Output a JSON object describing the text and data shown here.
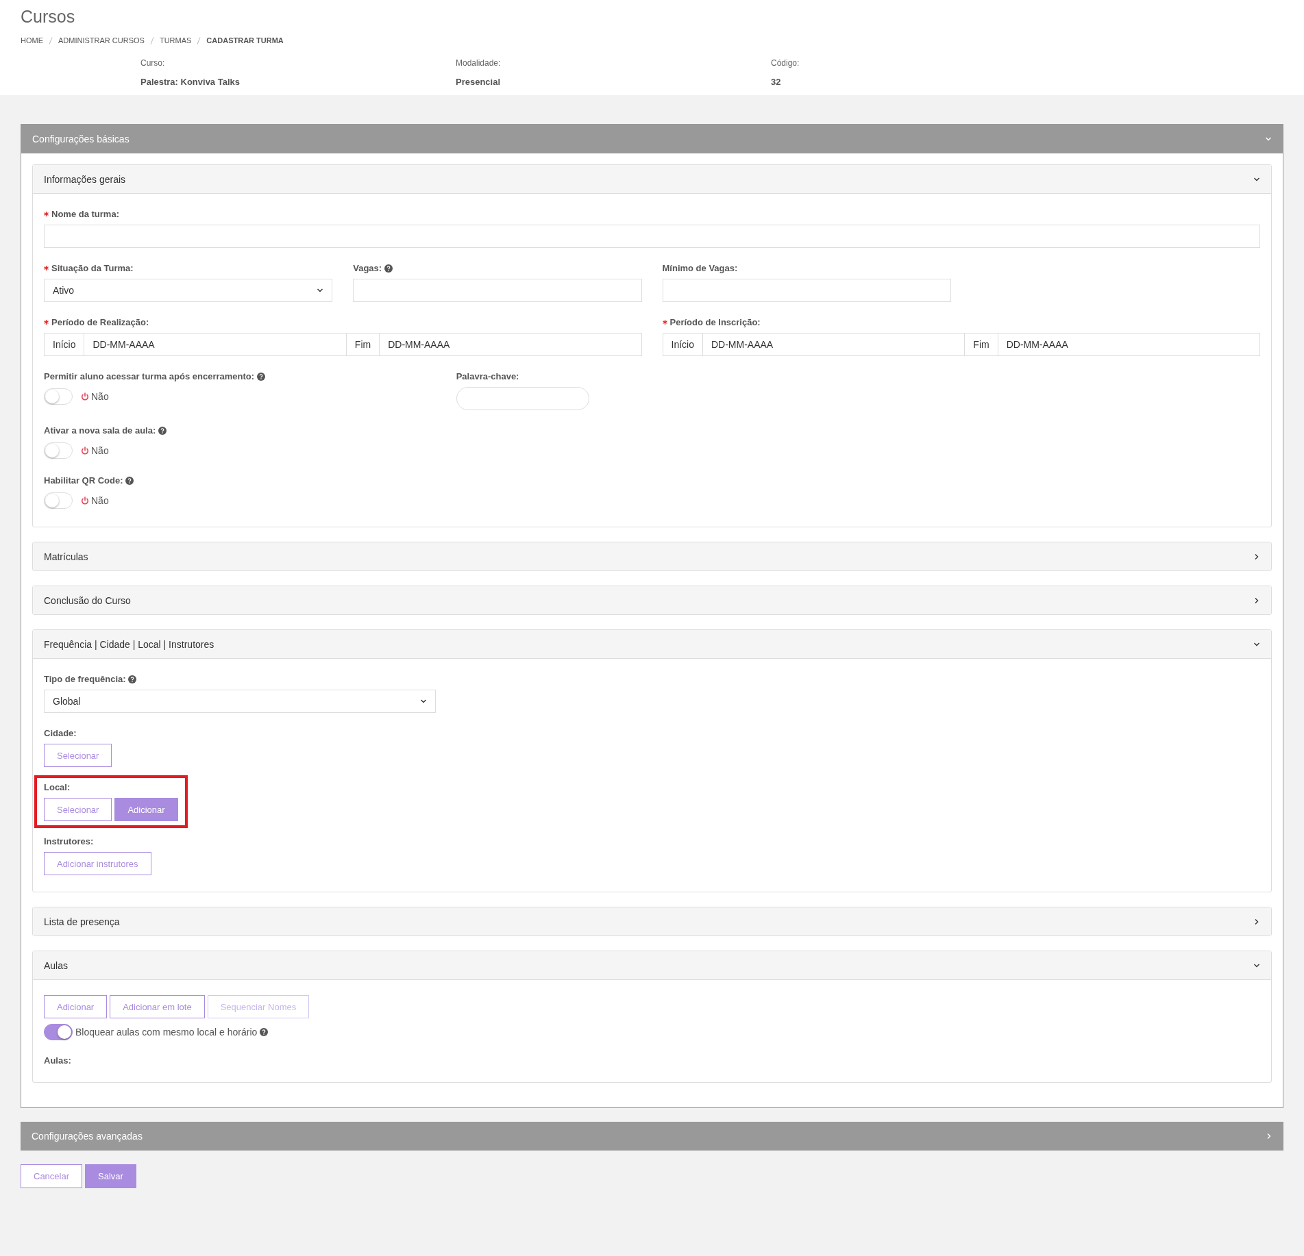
{
  "page": {
    "title": "Cursos"
  },
  "breadcrumb": [
    {
      "label": "HOME",
      "current": false
    },
    {
      "label": "ADMINISTRAR CURSOS",
      "current": false
    },
    {
      "label": "TURMAS",
      "current": false
    },
    {
      "label": "CADASTRAR TURMA",
      "current": true
    }
  ],
  "course_info": [
    {
      "label": "Curso:",
      "value": "Palestra: Konviva Talks"
    },
    {
      "label": "Modalidade:",
      "value": "Presencial"
    },
    {
      "label": "Código:",
      "value": "32"
    }
  ],
  "sections": [
    {
      "title": "Configurações básicas",
      "expanded": true,
      "panels": [
        {
          "title": "Informações gerais",
          "expanded": true,
          "rows": [
            {
              "fields": [
                {
                  "kind": "text",
                  "label": "Nome da turma:",
                  "required": true,
                  "help": false
                }
              ]
            },
            {
              "fields": [
                {
                  "kind": "select",
                  "label": "Situação da Turma:",
                  "required": true,
                  "help": false,
                  "value": "Ativo"
                },
                {
                  "kind": "text",
                  "label": "Vagas:",
                  "required": false,
                  "help": true
                },
                {
                  "kind": "text",
                  "label": "Mínimo de Vagas:",
                  "required": false,
                  "help": false
                }
              ]
            },
            {
              "fields": [
                {
                  "kind": "daterange",
                  "label": "Período de Realização:",
                  "required": true,
                  "help": false,
                  "start_label": "Início",
                  "start_value": "DD-MM-AAAA",
                  "end_label": "Fim",
                  "end_value": "DD-MM-AAAA"
                },
                {
                  "kind": "daterange",
                  "label": "Período de Inscrição:",
                  "required": true,
                  "help": false,
                  "start_label": "Início",
                  "start_value": "DD-MM-AAAA",
                  "end_label": "Fim",
                  "end_value": "DD-MM-AAAA"
                }
              ]
            },
            {
              "fields": [
                {
                  "kind": "toggle",
                  "label": "Permitir aluno acessar turma após encerramento:",
                  "required": false,
                  "help": true,
                  "on": false,
                  "state_text": "Não"
                },
                {
                  "kind": "keyword",
                  "label": "Palavra-chave:",
                  "required": false,
                  "help": false
                }
              ]
            },
            {
              "fields": [
                {
                  "kind": "toggle",
                  "label": "Ativar a nova sala de aula:",
                  "required": false,
                  "help": true,
                  "on": false,
                  "state_text": "Não"
                }
              ]
            },
            {
              "fields": [
                {
                  "kind": "toggle",
                  "label": "Habilitar QR Code:",
                  "required": false,
                  "help": true,
                  "on": false,
                  "state_text": "Não"
                }
              ]
            }
          ]
        },
        {
          "title": "Matrículas",
          "expanded": false
        },
        {
          "title": "Conclusão do Curso",
          "expanded": false
        },
        {
          "title": "Frequência | Cidade | Local | Instrutores",
          "expanded": true,
          "rows": [
            {
              "fields": [
                {
                  "kind": "select",
                  "label": "Tipo de frequência:",
                  "required": false,
                  "help": true,
                  "value": "Global"
                }
              ]
            },
            {
              "fields": [
                {
                  "kind": "buttons",
                  "label": "Cidade:",
                  "highlighted": false,
                  "buttons": [
                    {
                      "label": "Selecionar",
                      "primary": false,
                      "disabled": false
                    }
                  ]
                }
              ]
            },
            {
              "fields": [
                {
                  "kind": "buttons",
                  "label": "Local:",
                  "highlighted": true,
                  "buttons": [
                    {
                      "label": "Selecionar",
                      "primary": false,
                      "disabled": false
                    },
                    {
                      "label": "Adicionar",
                      "primary": true,
                      "disabled": false
                    }
                  ]
                }
              ]
            },
            {
              "fields": [
                {
                  "kind": "buttons",
                  "label": "Instrutores:",
                  "highlighted": false,
                  "buttons": [
                    {
                      "label": "Adicionar instrutores",
                      "primary": false,
                      "disabled": false
                    }
                  ]
                }
              ]
            }
          ]
        },
        {
          "title": "Lista de presença",
          "expanded": false
        },
        {
          "title": "Aulas",
          "expanded": true,
          "rows": [
            {
              "fields": [
                {
                  "kind": "buttons",
                  "buttons": [
                    {
                      "label": "Adicionar",
                      "primary": false,
                      "disabled": false
                    },
                    {
                      "label": "Adicionar em lote",
                      "primary": false,
                      "disabled": false
                    },
                    {
                      "label": "Sequenciar Nomes",
                      "primary": false,
                      "disabled": true
                    }
                  ]
                }
              ]
            },
            {
              "fields": [
                {
                  "kind": "inline-toggle",
                  "label": "Bloquear aulas com mesmo local e horário",
                  "help": true,
                  "on": true
                }
              ]
            },
            {
              "fields": [
                {
                  "kind": "heading",
                  "label": "Aulas:"
                }
              ]
            }
          ]
        }
      ]
    },
    {
      "title": "Configurações avançadas",
      "expanded": false
    }
  ],
  "actions": [
    {
      "label": "Cancelar",
      "primary": false
    },
    {
      "label": "Salvar",
      "primary": true
    }
  ]
}
